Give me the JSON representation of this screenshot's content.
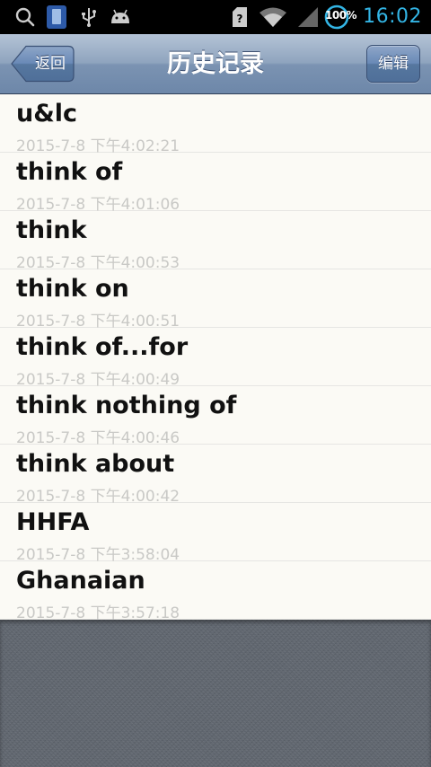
{
  "status_bar": {
    "time": "16:02",
    "battery": "100%",
    "icons": [
      "search-icon",
      "phone-icon",
      "usb-icon",
      "android-debug-icon",
      "sim-icon",
      "wifi-icon",
      "signal-icon",
      "battery-icon"
    ]
  },
  "nav": {
    "title": "历史记录",
    "back_label": "返回",
    "edit_label": "编辑"
  },
  "history": [
    {
      "word": "u&lc",
      "timestamp": "2015-7-8 下午4:02:21"
    },
    {
      "word": "think of",
      "timestamp": "2015-7-8 下午4:01:06"
    },
    {
      "word": "think",
      "timestamp": "2015-7-8 下午4:00:53"
    },
    {
      "word": "think on",
      "timestamp": "2015-7-8 下午4:00:51"
    },
    {
      "word": "think of...for",
      "timestamp": "2015-7-8 下午4:00:49"
    },
    {
      "word": "think nothing of",
      "timestamp": "2015-7-8 下午4:00:46"
    },
    {
      "word": "think about",
      "timestamp": "2015-7-8 下午4:00:42"
    },
    {
      "word": "HHFA",
      "timestamp": "2015-7-8 下午3:58:04"
    },
    {
      "word": "Ghanaian",
      "timestamp": "2015-7-8 下午3:57:18"
    }
  ],
  "colors": {
    "time_accent": "#33b5e5",
    "nav_bar": "#7b93b2",
    "row_background": "#fbfaf5",
    "timestamp_text": "#c9c9c6",
    "empty_background": "#5f656e"
  }
}
